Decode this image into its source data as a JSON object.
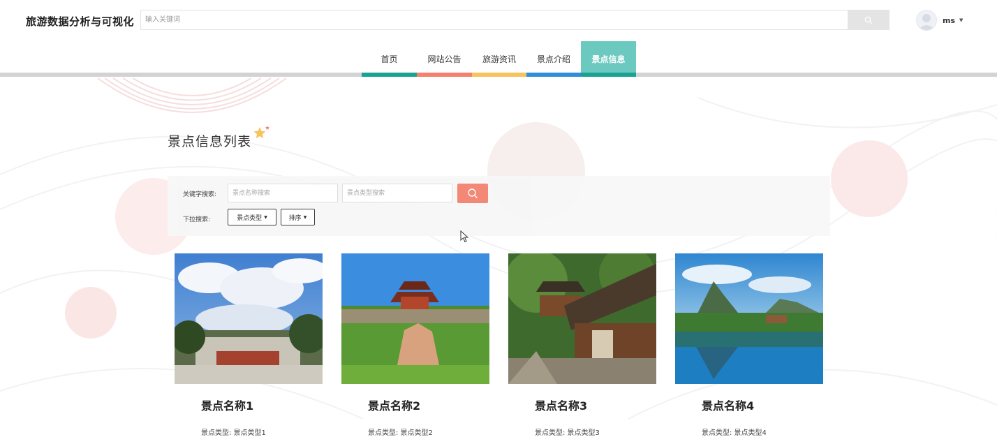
{
  "header": {
    "site_title": "旅游数据分析与可视化",
    "search_placeholder": "输入关键词",
    "search_icon": "search-icon",
    "user": {
      "name": "ms",
      "avatar_icon": "avatar-icon",
      "caret_icon": "caret-down-icon"
    }
  },
  "nav": {
    "items": [
      {
        "label": "首页",
        "underline_color": "#1aa394"
      },
      {
        "label": "网站公告",
        "underline_color": "#f4806d"
      },
      {
        "label": "旅游资讯",
        "underline_color": "#f7c35f"
      },
      {
        "label": "景点介绍",
        "underline_color": "#2f8fd8"
      },
      {
        "label": "景点信息",
        "underline_color": "#1aa394",
        "active": true
      }
    ],
    "active_bg": "#6cc9c0"
  },
  "main": {
    "title": "景点信息列表",
    "search": {
      "keyword_label": "关键字搜索:",
      "name_placeholder": "景点名称搜索",
      "type_placeholder": "景点类型搜索",
      "dropdown_label": "下拉搜索:",
      "type_dropdown": "景点类型",
      "sort_dropdown": "排序",
      "button_color": "#f4806d"
    },
    "cards": [
      {
        "name": "景点名称1",
        "type": "景点类型: 景点类型1"
      },
      {
        "name": "景点名称2",
        "type": "景点类型: 景点类型2"
      },
      {
        "name": "景点名称3",
        "type": "景点类型: 景点类型3"
      },
      {
        "name": "景点名称4",
        "type": "景点类型: 景点类型4"
      }
    ]
  }
}
